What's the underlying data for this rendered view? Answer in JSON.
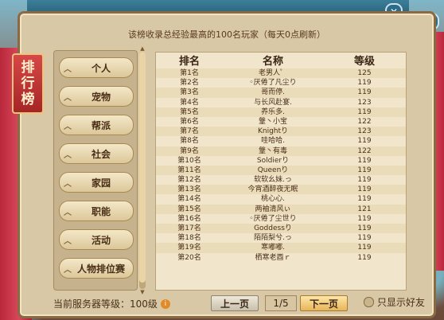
{
  "title": [
    "排",
    "行",
    "榜"
  ],
  "notice": "该榜收录总经验最高的100名玩家（每天0点刷新）",
  "sidebar": {
    "items": [
      {
        "label": "个人"
      },
      {
        "label": "宠物"
      },
      {
        "label": "帮派"
      },
      {
        "label": "社会"
      },
      {
        "label": "家园"
      },
      {
        "label": "职能"
      },
      {
        "label": "活动"
      },
      {
        "label": "人物排位赛"
      }
    ]
  },
  "table": {
    "headers": [
      "排名",
      "名称",
      "等级"
    ],
    "rows": [
      [
        "第1名",
        "老男人゜",
        "125"
      ],
      [
        "第2名",
        "◦厌倦了凡尘り",
        "119"
      ],
      [
        "第3名",
        "哥而停.",
        "119"
      ],
      [
        "第4名",
        "与长风赴宴.",
        "123"
      ],
      [
        "第5名",
        "养乐多.",
        "119"
      ],
      [
        "第6名",
        "鞶丶小宝",
        "122"
      ],
      [
        "第7名",
        "Knightり",
        "123"
      ],
      [
        "第8名",
        "哇哈哈.",
        "119"
      ],
      [
        "第9名",
        "鞶丶有毒",
        "122"
      ],
      [
        "第10名",
        "Soldierり",
        "119"
      ],
      [
        "第11名",
        "Queenり",
        "119"
      ],
      [
        "第12名",
        "软软幺妹.っ",
        "119"
      ],
      [
        "第13名",
        "今宵酒醉夜无眠",
        "119"
      ],
      [
        "第14名",
        "桃心心.",
        "119"
      ],
      [
        "第15名",
        "两袖清风ぃ",
        "121"
      ],
      [
        "第16名",
        "◦厌倦了尘世り",
        "119"
      ],
      [
        "第17名",
        "Goddessり",
        "119"
      ],
      [
        "第18名",
        "陌陌梨兮.っ",
        "119"
      ],
      [
        "第19名",
        "寒嘟嘟.",
        "119"
      ],
      [
        "第20名",
        "栖寒老酉ｒ",
        "119"
      ]
    ]
  },
  "footer": {
    "level_label": "当前服务器等级：100级",
    "prev_label": "上一页",
    "page_indicator": "1/5",
    "next_label": "下一页",
    "friends_label": "只显示好友"
  },
  "icons": {
    "close": "close-icon",
    "info": "info-icon",
    "chevron": "chevron-up-icon"
  }
}
